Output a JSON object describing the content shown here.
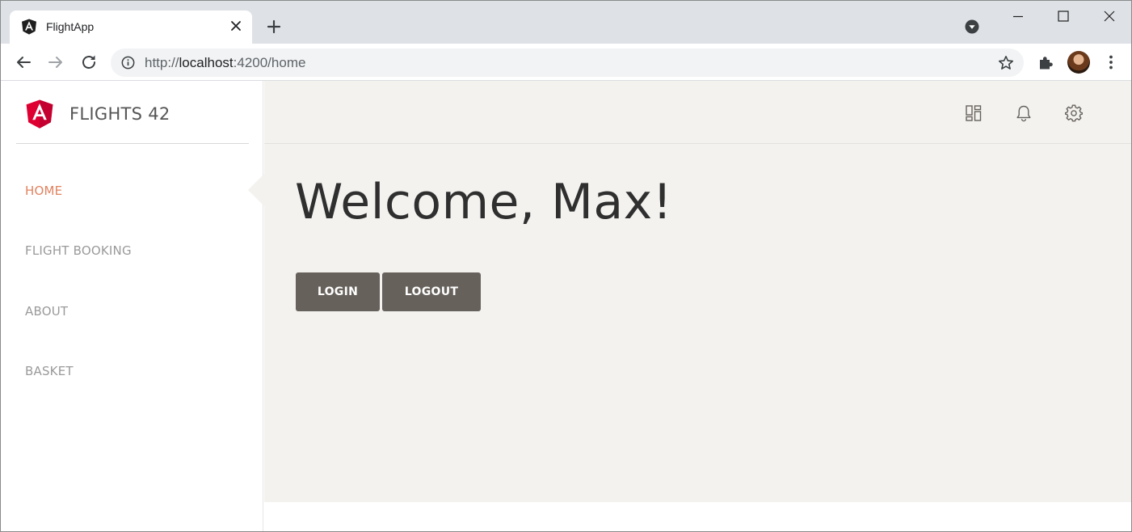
{
  "browser": {
    "tab": {
      "title": "FlightApp",
      "favicon": "angular-icon"
    },
    "address": {
      "scheme": "http://",
      "host": "localhost",
      "rest": ":4200/home"
    },
    "icons": {
      "new_tab": "plus-icon",
      "tab_search": "tab-search-icon",
      "minimize": "minimize-icon",
      "maximize": "maximize-icon",
      "close": "close-icon",
      "back": "back-arrow-icon",
      "forward": "forward-arrow-icon",
      "reload": "reload-icon",
      "info": "info-icon",
      "bookmark": "star-icon",
      "extensions": "puzzle-icon",
      "menu": "kebab-menu-icon"
    }
  },
  "app": {
    "brand": "FLIGHTS 42",
    "nav": [
      {
        "label": "HOME",
        "active": true
      },
      {
        "label": "FLIGHT BOOKING",
        "active": false
      },
      {
        "label": "ABOUT",
        "active": false
      },
      {
        "label": "BASKET",
        "active": false
      }
    ],
    "header_icons": [
      "dashboard-icon",
      "bell-icon",
      "gear-icon"
    ],
    "welcome": "Welcome, Max!",
    "buttons": {
      "login": "LOGIN",
      "logout": "LOGOUT"
    },
    "colors": {
      "accent": "#e2825e",
      "button": "#66615b",
      "content_bg": "#f3f2ef",
      "angular_red": "#dd0031"
    }
  }
}
